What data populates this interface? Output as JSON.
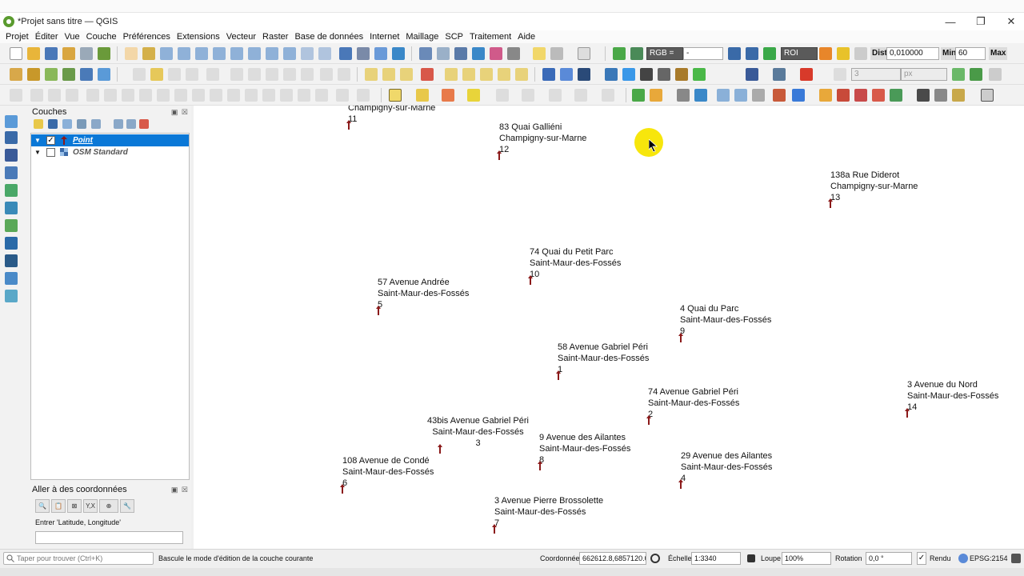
{
  "window": {
    "title": "*Projet sans titre — QGIS",
    "minimize": "—",
    "restore": "❐",
    "close": "✕"
  },
  "menus": [
    "Projet",
    "Éditer",
    "Vue",
    "Couche",
    "Préférences",
    "Extensions",
    "Vecteur",
    "Raster",
    "Base de données",
    "Internet",
    "Maillage",
    "SCP",
    "Traitement",
    "Aide"
  ],
  "toolbar1": {
    "rgb_label": "RGB =",
    "rgb_value": "-",
    "roi_label": "ROI",
    "dist_label": "Dist",
    "dist_value": "0,010000",
    "min_label": "Min",
    "min_value": "60",
    "max_label": "Max"
  },
  "toolbar2": {
    "size_value": "3",
    "unit_value": "px"
  },
  "layers_panel": {
    "title": "Couches",
    "layers": [
      {
        "name": "Point",
        "checked": true,
        "check_mark": "✓",
        "expander": "▼"
      },
      {
        "name": "OSM Standard",
        "checked": false,
        "check_mark": "",
        "expander": "▼"
      }
    ]
  },
  "goto_panel": {
    "title": "Aller à des coordonnées",
    "buttons": [
      "🔍",
      "📋",
      "⊠",
      "Y,X",
      "⊕",
      "🔧"
    ],
    "label": "Entrer 'Latitude, Longitude'",
    "input_value": ""
  },
  "map": {
    "points": [
      {
        "id": "11",
        "address": "",
        "city": "Champigny-sur-Marne"
      },
      {
        "id": "12",
        "address": "83 Quai Galliéni",
        "city": "Champigny-sur-Marne"
      },
      {
        "id": "13",
        "address": "138a Rue Diderot",
        "city": "Champigny-sur-Marne"
      },
      {
        "id": "10",
        "address": "74 Quai du Petit Parc",
        "city": "Saint-Maur-des-Fossés"
      },
      {
        "id": "5",
        "address": "57 Avenue Andrée",
        "city": "Saint-Maur-des-Fossés"
      },
      {
        "id": "9",
        "address": "4 Quai du Parc",
        "city": "Saint-Maur-des-Fossés"
      },
      {
        "id": "1",
        "address": "58 Avenue Gabriel Péri",
        "city": "Saint-Maur-des-Fossés"
      },
      {
        "id": "2",
        "address": "74 Avenue Gabriel Péri",
        "city": "Saint-Maur-des-Fossés"
      },
      {
        "id": "14",
        "address": "3 Avenue du Nord",
        "city": "Saint-Maur-des-Fossés"
      },
      {
        "id": "3",
        "address": "43bis Avenue Gabriel Péri",
        "city": "Saint-Maur-des-Fossés"
      },
      {
        "id": "8",
        "address": "9 Avenue des Ailantes",
        "city": "Saint-Maur-des-Fossés"
      },
      {
        "id": "6",
        "address": "108 Avenue de Condé",
        "city": "Saint-Maur-des-Fossés"
      },
      {
        "id": "4",
        "address": "29 Avenue des Ailantes",
        "city": "Saint-Maur-des-Fossés"
      },
      {
        "id": "7",
        "address": "3 Avenue Pierre Brossolette",
        "city": "Saint-Maur-des-Fossés"
      }
    ],
    "marker_color": "#8b1a1a"
  },
  "statusbar": {
    "search_placeholder": "Taper pour trouver (Ctrl+K)",
    "message": "Bascule le mode d'édition de la couche courante",
    "coord_label": "Coordonnée",
    "coord_value": "662612.8,6857120.0",
    "scale_label": "Échelle",
    "scale_value": "1:3340",
    "magnifier_label": "Loupe",
    "magnifier_value": "100%",
    "rotation_label": "Rotation",
    "rotation_value": "0,0 °",
    "render_label": "Rendu",
    "render_check": "✓",
    "crs": "EPSG:2154"
  },
  "colors": {
    "selection": "#0a78d7",
    "cursor_highlight": "#f7e60c",
    "qgis_green": "#5a9b2f"
  }
}
